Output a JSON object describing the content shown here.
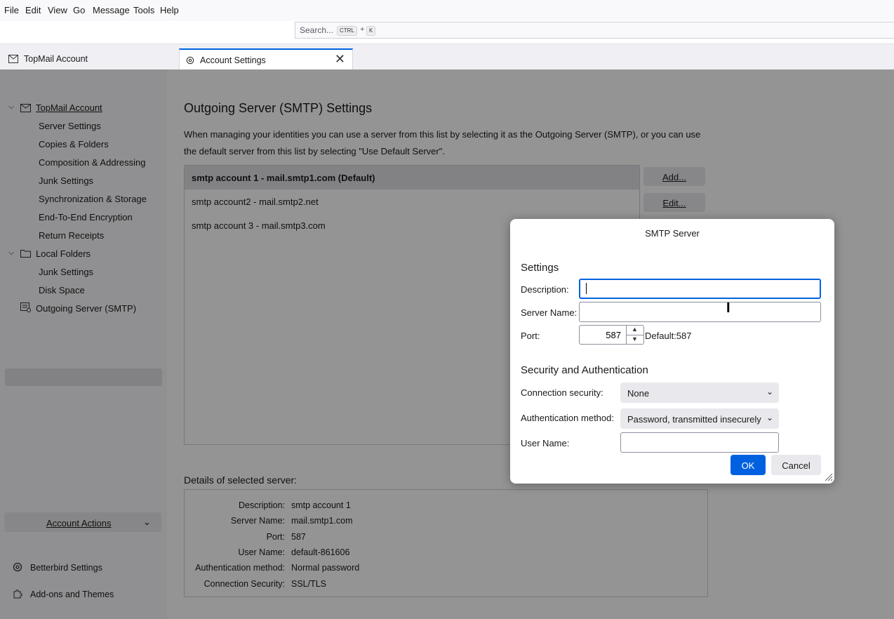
{
  "menubar": {
    "items": [
      "File",
      "Edit",
      "View",
      "Go",
      "Message",
      "Tools",
      "Help"
    ],
    "search_placeholder": "Search...",
    "shortcut_key1": "CTRL",
    "shortcut_plus": "+",
    "shortcut_key2": "K"
  },
  "tabs": [
    {
      "label": "TopMail Account",
      "icon": "mail-account-icon"
    },
    {
      "label": "Account Settings",
      "icon": "settings-gear-icon",
      "close": "✕"
    }
  ],
  "sidebar": {
    "account": "TopMail Account",
    "account_items": [
      "Server Settings",
      "Copies & Folders",
      "Composition & Addressing",
      "Junk Settings",
      "Synchronization & Storage",
      "End-To-End Encryption",
      "Return Receipts"
    ],
    "local_folders": "Local Folders",
    "local_items": [
      "Junk Settings",
      "Disk Space"
    ],
    "outgoing": "Outgoing Server (SMTP)",
    "account_actions": "Account Actions",
    "footer": [
      "Betterbird Settings",
      "Add-ons and Themes"
    ]
  },
  "main": {
    "title": "Outgoing Server (SMTP) Settings",
    "desc_line1": "When managing your identities you can use a server from this list by selecting it as the Outgoing Server (SMTP), or you can use",
    "desc_line2": "the default server from this list by selecting \"Use Default Server\".",
    "servers": [
      "smtp account 1 - mail.smtp1.com (Default)",
      "smtp account2 - mail.smtp2.net",
      "smtp account 3 - mail.smtp3.com"
    ],
    "add_button": "Add...",
    "edit_button": "Edit...",
    "details_title": "Details of selected server:",
    "details": [
      {
        "key": "Description:",
        "value": "smtp account 1"
      },
      {
        "key": "Server Name:",
        "value": "mail.smtp1.com"
      },
      {
        "key": "Port:",
        "value": "587"
      },
      {
        "key": "User Name:",
        "value": "default-861606"
      },
      {
        "key": "Authentication method:",
        "value": "Normal password"
      },
      {
        "key": "Connection Security:",
        "value": "SSL/TLS"
      }
    ]
  },
  "dialog": {
    "title": "SMTP Server",
    "settings_heading": "Settings",
    "description_label": "Description:",
    "description_value": "",
    "server_name_label": "Server Name:",
    "server_name_value": "",
    "port_label": "Port:",
    "port_value": "587",
    "port_default": "Default:587",
    "security_heading": "Security and Authentication",
    "conn_security_label": "Connection security:",
    "conn_security_value": "None",
    "auth_method_label": "Authentication method:",
    "auth_method_value": "Password, transmitted insecurely",
    "user_name_label": "User Name:",
    "user_name_value": "",
    "ok": "OK",
    "cancel": "Cancel"
  }
}
